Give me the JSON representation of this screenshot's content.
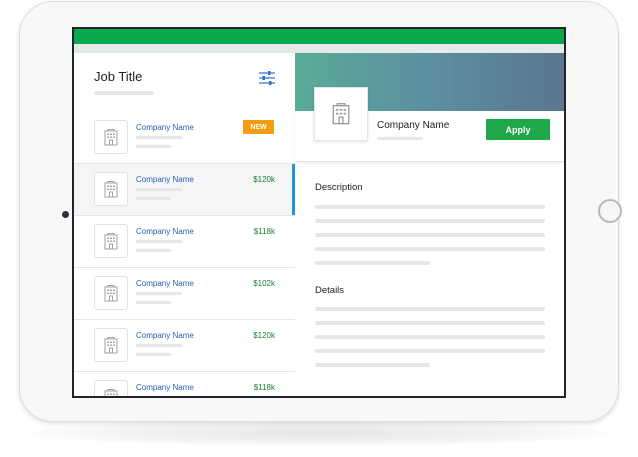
{
  "colors": {
    "brand_green": "#0aa84c",
    "link_blue": "#2a5fb0",
    "salary_green": "#1e7b33",
    "badge_orange": "#f39c12",
    "selected_accent": "#2196d6"
  },
  "list_panel": {
    "title": "Job Title",
    "filter_icon": "sliders-icon",
    "items": [
      {
        "company": "Company Name",
        "badge": "NEW",
        "salary": ""
      },
      {
        "company": "Company Name",
        "badge": "",
        "salary": "$120k",
        "selected": true
      },
      {
        "company": "Company Name",
        "badge": "",
        "salary": "$118k"
      },
      {
        "company": "Company Name",
        "badge": "",
        "salary": "$102k"
      },
      {
        "company": "Company Name",
        "badge": "",
        "salary": "$120k"
      },
      {
        "company": "Company Name",
        "badge": "",
        "salary": "$118k"
      }
    ]
  },
  "detail_panel": {
    "company": "Company Name",
    "apply_label": "Apply",
    "description_heading": "Description",
    "details_heading": "Details",
    "logo_icon": "building-icon"
  }
}
